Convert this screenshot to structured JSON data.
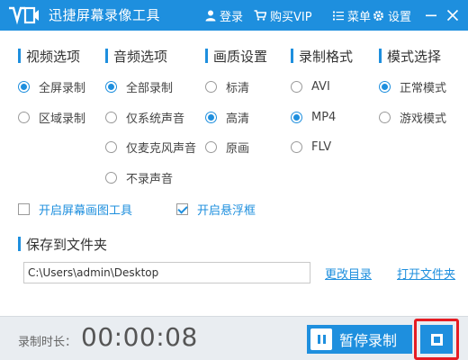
{
  "app": {
    "title": "迅捷屏幕录像工具"
  },
  "toolbar": {
    "login": "登录",
    "buy_vip": "购买VIP",
    "menu": "菜单",
    "settings": "设置"
  },
  "sections": {
    "video": {
      "title": "视频选项",
      "options": [
        "全屏录制",
        "区域录制"
      ],
      "selected": "全屏录制"
    },
    "audio": {
      "title": "音频选项",
      "options": [
        "全部录制",
        "仅系统声音",
        "仅麦克风声音",
        "不录声音"
      ],
      "selected": "全部录制"
    },
    "quality": {
      "title": "画质设置",
      "options": [
        "标清",
        "高清",
        "原画"
      ],
      "selected": "高清"
    },
    "format": {
      "title": "录制格式",
      "options": [
        "AVI",
        "MP4",
        "FLV"
      ],
      "selected": "MP4"
    },
    "mode": {
      "title": "模式选择",
      "options": [
        "正常模式",
        "游戏模式"
      ],
      "selected": "正常模式"
    }
  },
  "checkboxes": {
    "screen_draw": {
      "label": "开启屏幕画图工具",
      "checked": false
    },
    "float_window": {
      "label": "开启悬浮框",
      "checked": true
    }
  },
  "save": {
    "title": "保存到文件夹",
    "path": "C:\\Users\\admin\\Desktop",
    "change_dir": "更改目录",
    "open_folder": "打开文件夹"
  },
  "recording": {
    "duration_label": "录制时长：",
    "duration": "00:00:08",
    "pause_label": "暂停录制"
  },
  "colors": {
    "accent": "#1e8fde",
    "highlight": "#e51c23",
    "bottom_bar": "#e9edf1"
  }
}
